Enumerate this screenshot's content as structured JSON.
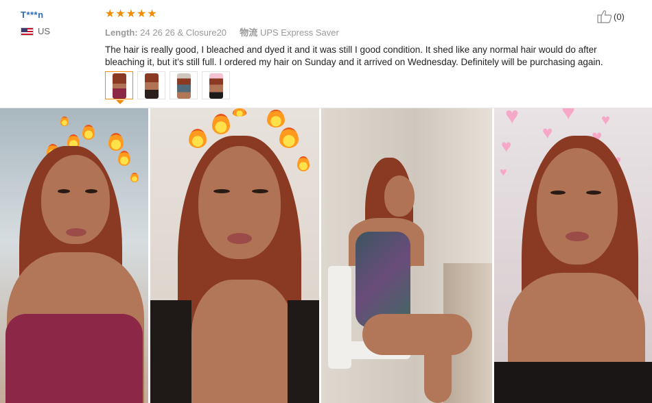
{
  "review": {
    "user": {
      "name": "T***n",
      "country": "US"
    },
    "rating": {
      "stars": 5,
      "max": 5
    },
    "meta": {
      "length_label": "Length:",
      "length_value": "24 26 26 & Closure20",
      "shipping_label": "物流",
      "shipping_value": "UPS Express Saver"
    },
    "text": "The hair is really good, I bleached and dyed it and it was still I good condition. It shed like any normal hair would do after bleaching it, but it’s still full. I ordered my hair on Sunday and it arrived on Wednesday. Definitely will be purchasing again.",
    "helpful": {
      "count": "(0)",
      "icon": "thumbs-up-icon"
    },
    "thumbnails": [
      {
        "name": "thumbnail-1",
        "selected": true
      },
      {
        "name": "thumbnail-2",
        "selected": false
      },
      {
        "name": "thumbnail-3",
        "selected": false
      },
      {
        "name": "thumbnail-4",
        "selected": false
      }
    ]
  },
  "colors": {
    "username": "#2a6fb5",
    "star": "#f28b00",
    "thumb_active_border": "#f28b00",
    "meta_text": "#999999"
  },
  "gallery": {
    "photos": [
      {
        "name": "review-photo-1"
      },
      {
        "name": "review-photo-2"
      },
      {
        "name": "review-photo-3"
      },
      {
        "name": "review-photo-4"
      }
    ]
  }
}
